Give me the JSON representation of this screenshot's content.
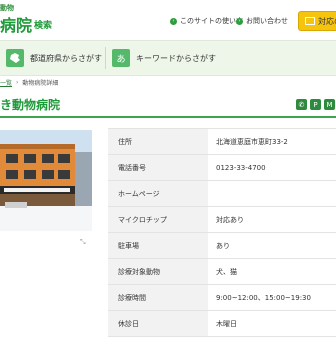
{
  "header": {
    "logo_small": "動物",
    "logo_main": "病院",
    "logo_sub": "検索",
    "links": [
      {
        "label": "このサイトの使い方"
      },
      {
        "label": "お問い合わせ"
      }
    ],
    "contact_label": "対応の"
  },
  "search": {
    "prefecture_label": "都道府県からさがす",
    "keyword_label": "キーワードからさがす",
    "keyword_icon": "あ"
  },
  "breadcrumb": {
    "home": "一覧",
    "separator": "›",
    "current": "動物病院詳細"
  },
  "title": "き動物病院",
  "title_icons": [
    "phone-icon",
    "parking-icon",
    "microchip-icon"
  ],
  "title_icon_glyphs": [
    "✆",
    "P",
    "M"
  ],
  "photo_zoom": "⤡",
  "info": [
    {
      "key": "住所",
      "value": "北海道恵庭市恵町33-2"
    },
    {
      "key": "電話番号",
      "value": "0123-33-4700"
    },
    {
      "key": "ホームページ",
      "value": ""
    },
    {
      "key": "マイクロチップ",
      "value": "対応あり"
    },
    {
      "key": "駐車場",
      "value": "あり"
    },
    {
      "key": "診療対象動物",
      "value": "犬、猫"
    },
    {
      "key": "診療時間",
      "value": "9:00~12:00、15:00~19:30"
    },
    {
      "key": "休診日",
      "value": "木曜日"
    }
  ],
  "colors": {
    "brand_green": "#1f9a3a",
    "search_bg": "#eef5e9",
    "contact_yellow": "#f5c40f"
  }
}
